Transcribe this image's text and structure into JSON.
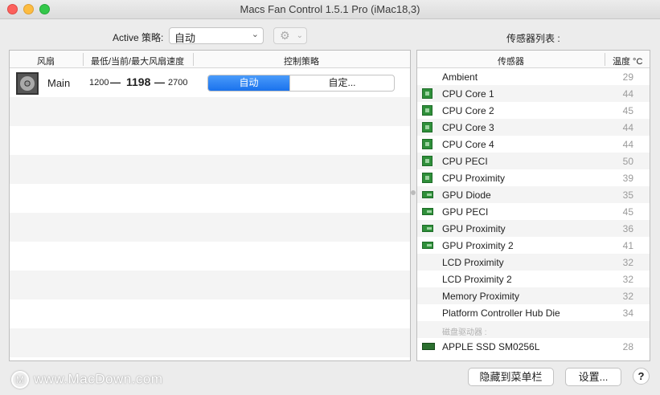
{
  "window": {
    "title": "Macs Fan Control 1.5.1 Pro (iMac18,3)"
  },
  "toolbar": {
    "policy_label": "Active 策略:",
    "policy_value": "自动",
    "sensor_list_label": "传感器列表 :"
  },
  "fans": {
    "headers": {
      "fan": "风扇",
      "speed": "最低/当前/最大风扇速度",
      "control": "控制策略"
    },
    "items": [
      {
        "name": "Main",
        "min": "1200",
        "current": "1198",
        "max": "2700",
        "dash": "—",
        "mode_auto": "自动",
        "mode_custom": "自定..."
      }
    ]
  },
  "sensors": {
    "headers": {
      "name": "传感器",
      "temp": "温度 °C"
    },
    "items": [
      {
        "name": "Ambient",
        "value": "29",
        "icon": "none"
      },
      {
        "name": "CPU Core 1",
        "value": "44",
        "icon": "cpu"
      },
      {
        "name": "CPU Core 2",
        "value": "45",
        "icon": "cpu"
      },
      {
        "name": "CPU Core 3",
        "value": "44",
        "icon": "cpu"
      },
      {
        "name": "CPU Core 4",
        "value": "44",
        "icon": "cpu"
      },
      {
        "name": "CPU PECI",
        "value": "50",
        "icon": "cpu"
      },
      {
        "name": "CPU Proximity",
        "value": "39",
        "icon": "cpu"
      },
      {
        "name": "GPU Diode",
        "value": "35",
        "icon": "gpu"
      },
      {
        "name": "GPU PECI",
        "value": "45",
        "icon": "gpu"
      },
      {
        "name": "GPU Proximity",
        "value": "36",
        "icon": "gpu"
      },
      {
        "name": "GPU Proximity 2",
        "value": "41",
        "icon": "gpu"
      },
      {
        "name": "LCD Proximity",
        "value": "32",
        "icon": "none"
      },
      {
        "name": "LCD Proximity 2",
        "value": "32",
        "icon": "none"
      },
      {
        "name": "Memory Proximity",
        "value": "32",
        "icon": "none"
      },
      {
        "name": "Platform Controller Hub Die",
        "value": "34",
        "icon": "none"
      },
      {
        "name": "磁盘驱动器 :",
        "value": "",
        "icon": "none",
        "group": true
      },
      {
        "name": "APPLE SSD SM0256L",
        "value": "28",
        "icon": "ssd"
      }
    ]
  },
  "footer": {
    "watermark": "www.MacDown.com",
    "hide_button": "隐藏到菜单栏",
    "settings_button": "设置...",
    "help_button": "?"
  },
  "colors": {
    "accent": "#1a72ed",
    "sensor_icon": "#2f8f3a"
  }
}
